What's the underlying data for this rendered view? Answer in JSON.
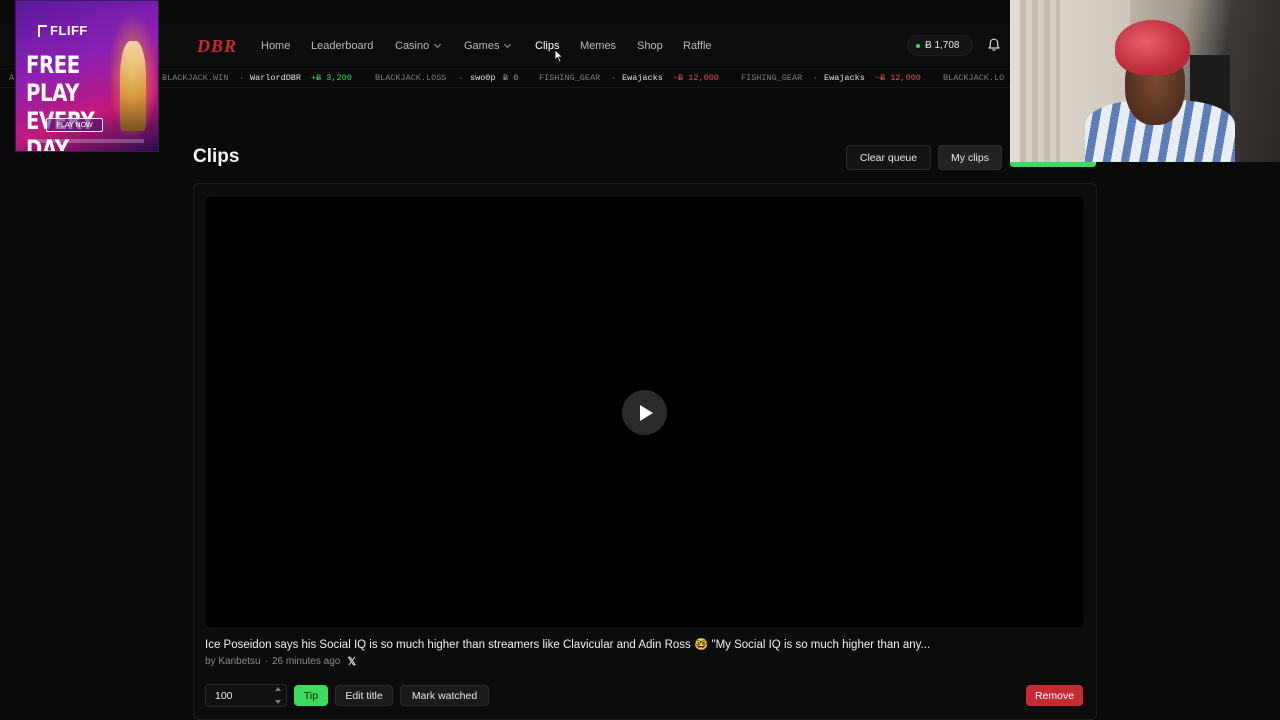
{
  "nav": {
    "logo": "DBR",
    "items": [
      {
        "label": "Home"
      },
      {
        "label": "Leaderboard"
      },
      {
        "label": "Casino"
      },
      {
        "label": "Games"
      },
      {
        "label": "Clips"
      },
      {
        "label": "Memes"
      },
      {
        "label": "Shop"
      },
      {
        "label": "Raffle"
      }
    ],
    "active_item": "Clips",
    "balance": "Ƀ 1,708",
    "balance_status_color": "#3ddc5f",
    "icons": {
      "bell": "bell-icon",
      "dropdown": "chevron-down-icon"
    }
  },
  "ticker": {
    "lead": "A",
    "entries": [
      {
        "event": "BLACKJACK.WIN",
        "user": "WarlordDBR",
        "amount": "+Ƀ 3,200",
        "kind": "win"
      },
      {
        "event": "BLACKJACK.LOSS",
        "user": "swo0p",
        "amount": "Ƀ 0",
        "kind": "zero"
      },
      {
        "event": "FISHING_GEAR",
        "user": "Ewajacks",
        "amount": "−Ƀ 12,000",
        "kind": "loss"
      },
      {
        "event": "FISHING_GEAR",
        "user": "Ewajacks",
        "amount": "−Ƀ 12,000",
        "kind": "loss"
      },
      {
        "event": "BLACKJACK.LO",
        "user": "",
        "amount": "",
        "kind": "zero"
      }
    ],
    "separator": "·"
  },
  "page": {
    "title": "Clips",
    "clear_queue_label": "Clear queue",
    "my_clips_label": "My clips"
  },
  "clip": {
    "title": "Ice Poseidon says his Social IQ is so much higher than streamers like Clavicular and Adin Ross 🤓 \"My Social IQ is so much higher than any...",
    "author": "by Kanbetsu",
    "time": "26 minutes ago",
    "meta_separator": "·",
    "source_icon": "x-logo-icon",
    "play_icon": "play-icon"
  },
  "controls": {
    "tip_amount": "100",
    "tip_label": "Tip",
    "edit_title_label": "Edit title",
    "mark_watched_label": "Mark watched",
    "remove_label": "Remove"
  },
  "ad": {
    "brand": "FLIFF",
    "headline": "FREE PLAY EVERY DAY",
    "cta": "PLAY NOW"
  },
  "colors": {
    "accent_green": "#3ddc5f",
    "danger_red": "#c72b32",
    "logo_red": "#c92a2a",
    "background": "#0a0a0b"
  }
}
